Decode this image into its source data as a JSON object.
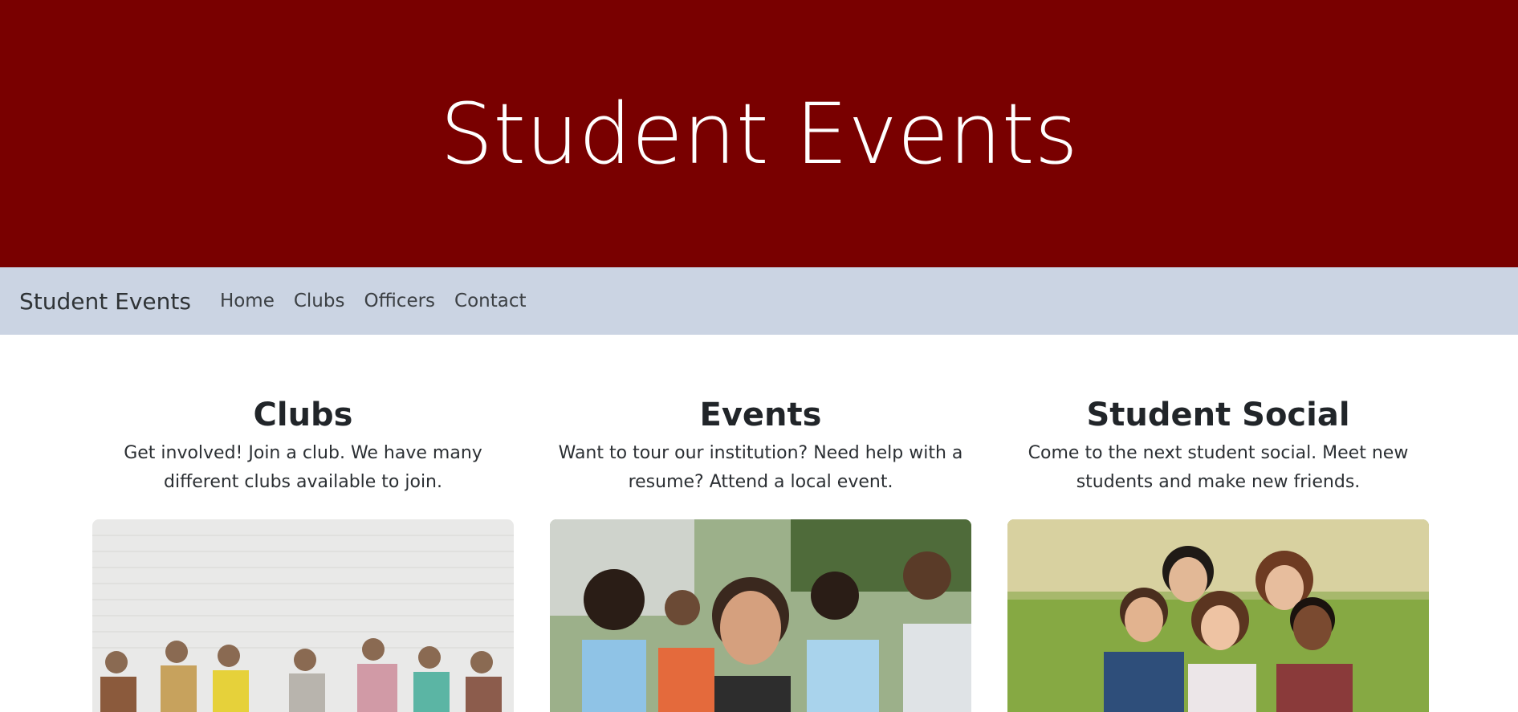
{
  "hero": {
    "title": "Student Events"
  },
  "nav": {
    "brand": "Student Events",
    "links": [
      "Home",
      "Clubs",
      "Officers",
      "Contact"
    ]
  },
  "cards": [
    {
      "title": "Clubs",
      "text": "Get involved! Join a club. We have many different clubs available to join.",
      "image": "students-sitting-against-white-brick-wall"
    },
    {
      "title": "Events",
      "text": "Want to tour our institution? Need help with a resume? Attend a local event.",
      "image": "smiling-student-in-crowd-outdoors"
    },
    {
      "title": "Student Social",
      "text": "Come to the next student social. Meet new students and make new friends.",
      "image": "group-of-smiling-students-in-park"
    }
  ],
  "colors": {
    "hero_bg": "#790000",
    "navbar_bg": "#cbd4e3"
  }
}
